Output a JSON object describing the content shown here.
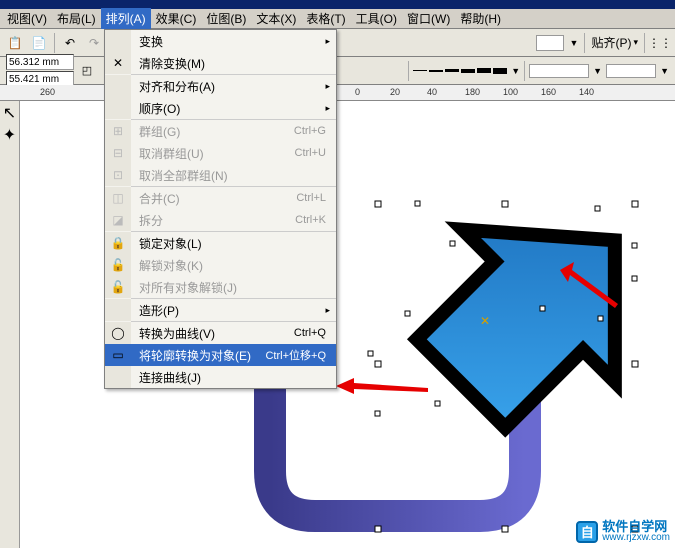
{
  "menubar": {
    "items": [
      "视图(V)",
      "布局(L)",
      "排列(A)",
      "效果(C)",
      "位图(B)",
      "文本(X)",
      "表格(T)",
      "工具(O)",
      "窗口(W)",
      "帮助(H)"
    ],
    "active_index": 2
  },
  "toolbar": {
    "paste_label": "贴齐(P)"
  },
  "dimensions": {
    "width": "56.312 mm",
    "height": "55.421 mm"
  },
  "ruler": {
    "ticks": [
      "260",
      "0",
      "20",
      "40",
      "180",
      "100",
      "160",
      "140"
    ]
  },
  "dropdown": {
    "items": [
      {
        "icon": "",
        "label": "变换",
        "shortcut": "",
        "hasSubmenu": true,
        "disabled": false
      },
      {
        "icon": "clear-icon",
        "label": "清除变换(M)",
        "shortcut": "",
        "disabled": false
      },
      {
        "sep": true
      },
      {
        "icon": "",
        "label": "对齐和分布(A)",
        "shortcut": "",
        "hasSubmenu": true,
        "disabled": false
      },
      {
        "icon": "",
        "label": "顺序(O)",
        "shortcut": "",
        "hasSubmenu": true,
        "disabled": false
      },
      {
        "sep": true
      },
      {
        "icon": "group-icon",
        "label": "群组(G)",
        "shortcut": "Ctrl+G",
        "disabled": true
      },
      {
        "icon": "ungroup-icon",
        "label": "取消群组(U)",
        "shortcut": "Ctrl+U",
        "disabled": true
      },
      {
        "icon": "ungroup-all-icon",
        "label": "取消全部群组(N)",
        "shortcut": "",
        "disabled": true
      },
      {
        "sep": true
      },
      {
        "icon": "combine-icon",
        "label": "合并(C)",
        "shortcut": "Ctrl+L",
        "disabled": true
      },
      {
        "icon": "break-icon",
        "label": "拆分",
        "shortcut": "Ctrl+K",
        "disabled": true
      },
      {
        "sep": true
      },
      {
        "icon": "lock-icon",
        "label": "锁定对象(L)",
        "shortcut": "",
        "disabled": false
      },
      {
        "icon": "unlock-icon",
        "label": "解锁对象(K)",
        "shortcut": "",
        "disabled": true
      },
      {
        "icon": "unlock-all-icon",
        "label": "对所有对象解锁(J)",
        "shortcut": "",
        "disabled": true
      },
      {
        "sep": true
      },
      {
        "icon": "",
        "label": "造形(P)",
        "shortcut": "",
        "hasSubmenu": true,
        "disabled": false
      },
      {
        "sep": true
      },
      {
        "icon": "curve-icon",
        "label": "转换为曲线(V)",
        "shortcut": "Ctrl+Q",
        "disabled": false
      },
      {
        "icon": "outline-icon",
        "label": "将轮廓转换为对象(E)",
        "shortcut": "Ctrl+位移+Q",
        "disabled": false,
        "highlight": true
      },
      {
        "icon": "",
        "label": "连接曲线(J)",
        "shortcut": "",
        "disabled": false
      }
    ]
  },
  "watermark": {
    "cn": "软件自学网",
    "url": "www.rjzxw.com",
    "logo": "自"
  }
}
